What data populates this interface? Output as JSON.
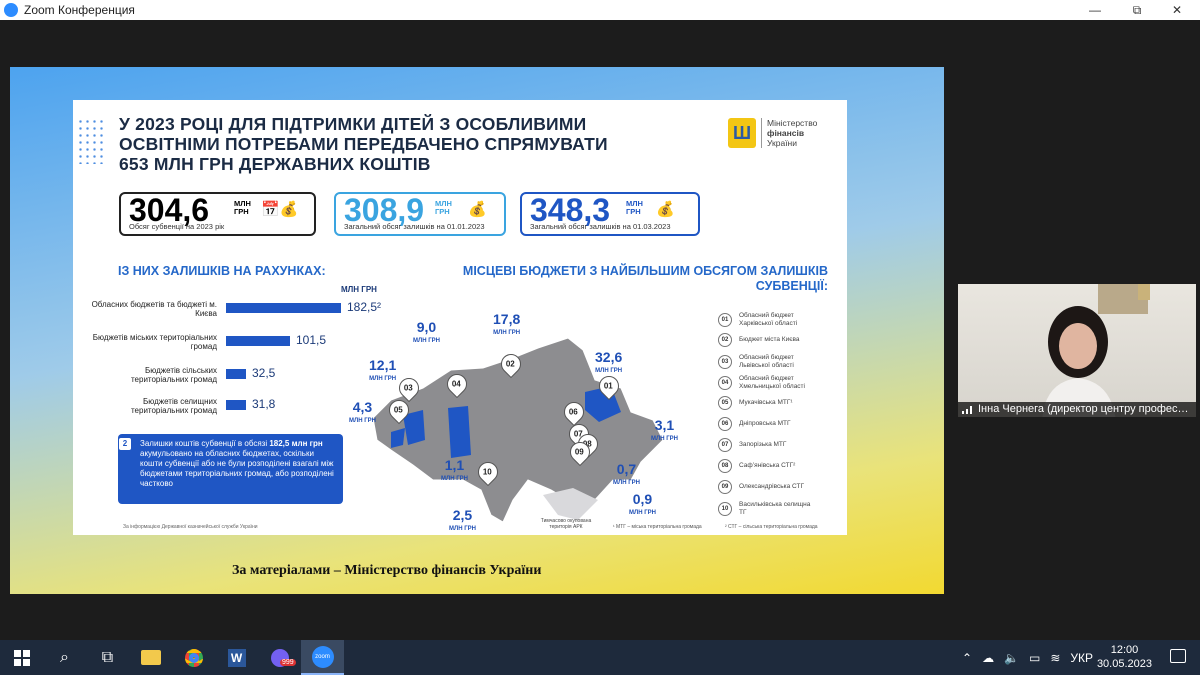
{
  "window": {
    "title": "Zoom Конференция",
    "minimize": "—",
    "restore": "⧉",
    "close": "✕"
  },
  "slide": {
    "headline_lines": [
      "У 2023 РОЦІ ДЛЯ ПІДТРИМКИ ДІТЕЙ З ОСОБЛИВИМИ",
      "ОСВІТНІМИ ПОТРЕБАМИ ПЕРЕДБАЧЕНО СПРЯМУВАТИ",
      "653 МЛН ГРН ДЕРЖАВНИХ КОШТІВ"
    ],
    "logo": {
      "line1": "Міністерство",
      "line2": "фінансів",
      "line3": "України"
    },
    "stats": [
      {
        "value": "304,6",
        "unit1": "МЛН",
        "unit2": "ГРН",
        "label": "Обсяг субвенції на 2023 рік",
        "color": "#111111"
      },
      {
        "value": "308,9",
        "unit1": "МЛН",
        "unit2": "ГРН",
        "label": "Загальний обсяг залишків на 01.01.2023",
        "color": "#3aa4e0"
      },
      {
        "value": "348,3",
        "unit1": "МЛН",
        "unit2": "ГРН",
        "label": "Загальний обсяг залишків на 01.03.2023",
        "color": "#1f56c4"
      }
    ],
    "left_heading": "ІЗ НИХ ЗАЛИШКІВ НА РАХУНКАХ:",
    "bar_unit": "МЛН ГРН",
    "bars": [
      {
        "label": "Обласних бюджетів та бюджеті м. Києва",
        "value": 182.5,
        "display": "182,5²"
      },
      {
        "label": "Бюджетів міських територіальних громад",
        "value": 101.5,
        "display": "101,5"
      },
      {
        "label": "Бюджетів сільських територіальних громад",
        "value": 32.5,
        "display": "32,5"
      },
      {
        "label": "Бюджетів селищних територіальних громад",
        "value": 31.8,
        "display": "31,8"
      }
    ],
    "note_badge": "2",
    "note_text_1": "Залишки коштів субвенції в обсязі ",
    "note_bold": "182,5 млн грн",
    "note_text_2": " акумульовано на обласних бюджетах, оскільки кошти субвенції або не були розподілені взагалі між бюджетами територіальних громад, або розподілені частково",
    "source": "За інформацією Державної казначейської служби України",
    "right_heading_1": "МІСЦЕВІ БЮДЖЕТИ З НАЙБІЛЬШИМ ОБСЯГОМ ЗАЛИШКІВ",
    "right_heading_2": "СУБВЕНЦІЇ:",
    "map_unit": "МЛН ГРН",
    "map_values": [
      "9,0",
      "17,8",
      "12,1",
      "32,6",
      "4,3",
      "3,1",
      "1,1",
      "0,7",
      "2,5",
      "0,9"
    ],
    "crimea_label": "Тимчасово окупована територія АРК",
    "legend": [
      {
        "n": "01",
        "text": "Обласний бюджет Харківської області"
      },
      {
        "n": "02",
        "text": "Бюджет міста Києва"
      },
      {
        "n": "03",
        "text": "Обласний бюджет Львівської області"
      },
      {
        "n": "04",
        "text": "Обласний бюджет Хмельницької області"
      },
      {
        "n": "05",
        "text": "Мукачівська МТГ¹"
      },
      {
        "n": "06",
        "text": "Дніпровська МТГ"
      },
      {
        "n": "07",
        "text": "Запорізька МТГ"
      },
      {
        "n": "08",
        "text": "Сафʼянівська СТГ²"
      },
      {
        "n": "09",
        "text": "Олександрівська СТГ"
      },
      {
        "n": "10",
        "text": "Васильківська селищна ТГ"
      }
    ],
    "footnote1": "¹ МТГ – міська територіальна громада",
    "footnote2": "² СТГ – сільська територіальна громада"
  },
  "caption": "За матеріалами – Міністерство фінансів України",
  "participant": {
    "name": "Інна Чернега (директор центру профес…"
  },
  "taskbar": {
    "lang": "УКР",
    "time": "12:00",
    "date": "30.05.2023",
    "viber_badge": "999",
    "zoom_label": "zoom"
  }
}
